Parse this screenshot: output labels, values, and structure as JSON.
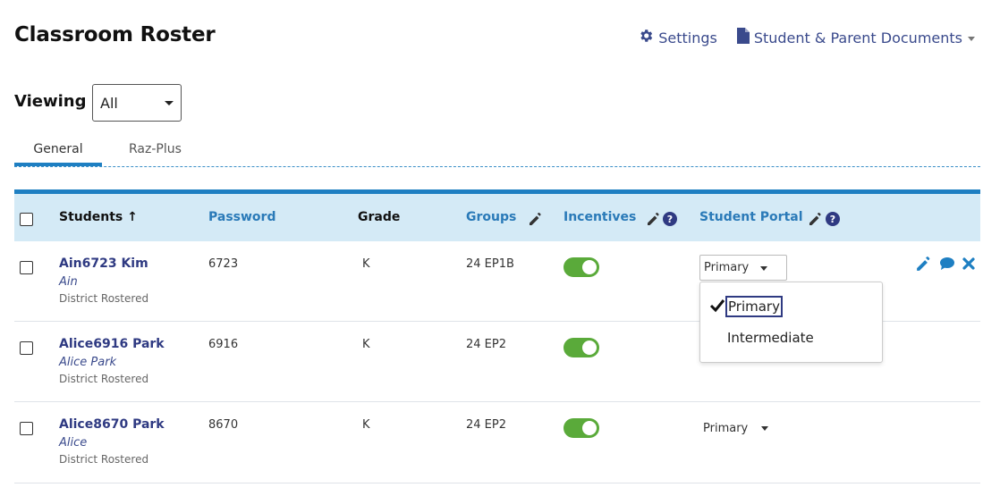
{
  "page": {
    "title": "Classroom Roster"
  },
  "header_links": {
    "settings": "Settings",
    "documents": "Student & Parent Documents"
  },
  "viewing": {
    "label": "Viewing",
    "value": "All"
  },
  "tabs": [
    {
      "label": "General",
      "active": true
    },
    {
      "label": "Raz-Plus",
      "active": false
    }
  ],
  "table": {
    "columns": {
      "students": "Students",
      "password": "Password",
      "grade": "Grade",
      "groups": "Groups",
      "incentives": "Incentives",
      "portal": "Student Portal"
    },
    "sort_indicator": "↑",
    "rows": [
      {
        "name": "Ain6723 Kim",
        "alias": "Ain",
        "source": "District Rostered",
        "password": "6723",
        "grade": "K",
        "group": "24 EP1B",
        "incentives_on": true,
        "portal": "Primary"
      },
      {
        "name": "Alice6916 Park",
        "alias": "Alice Park",
        "source": "District Rostered",
        "password": "6916",
        "grade": "K",
        "group": "24 EP2",
        "incentives_on": true,
        "portal": "Primary"
      },
      {
        "name": "Alice8670 Park",
        "alias": "Alice",
        "source": "District Rostered",
        "password": "8670",
        "grade": "K",
        "group": "24 EP2",
        "incentives_on": true,
        "portal": "Primary"
      }
    ]
  },
  "portal_menu": {
    "options": [
      "Primary",
      "Intermediate"
    ],
    "selected": "Primary"
  },
  "colors": {
    "accent_blue": "#1e7fc2",
    "header_bg": "#d4eaf6",
    "link_navy": "#2f3a82",
    "toggle_green": "#5aaa3a"
  },
  "icons": {
    "settings": "gear-icon",
    "documents": "document-icon",
    "edit": "pencil-icon",
    "help": "question-circle-icon",
    "comment": "speech-bubble-icon",
    "remove": "close-x-icon",
    "check": "checkmark-icon"
  }
}
